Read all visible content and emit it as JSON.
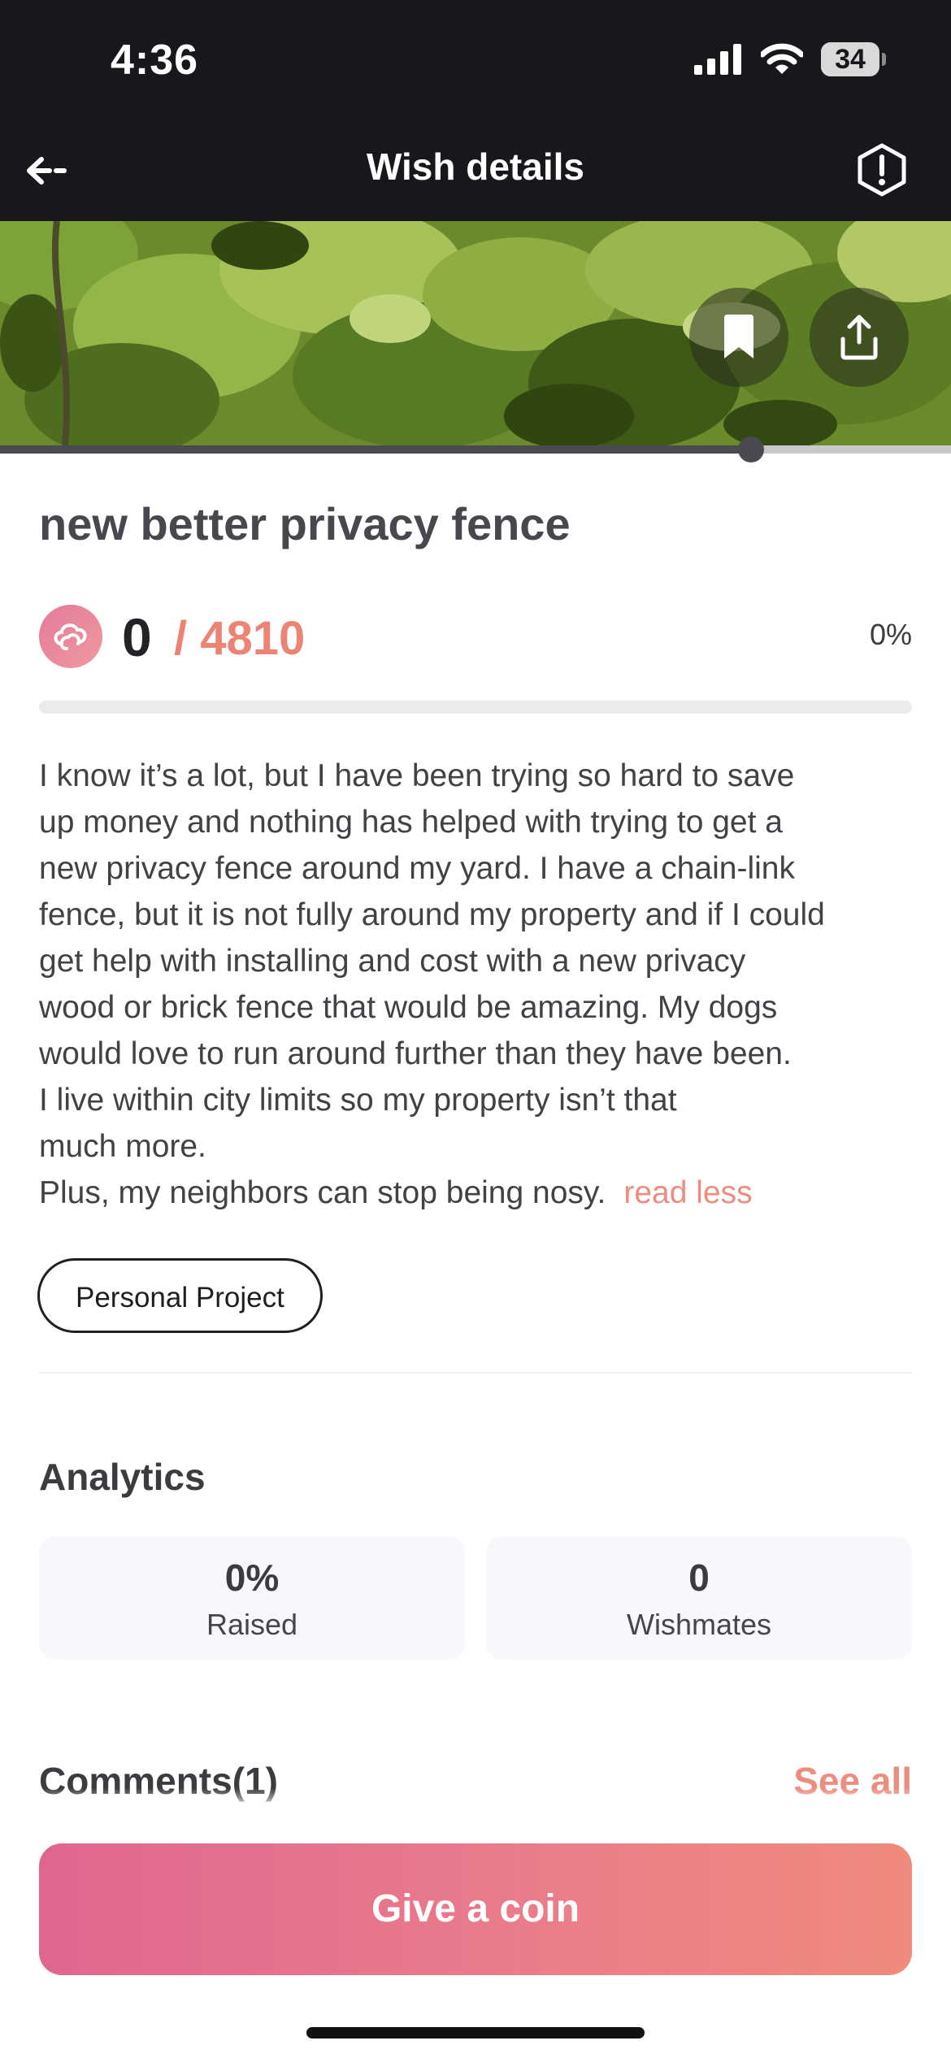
{
  "status_bar": {
    "time": "4:36",
    "battery": "34",
    "battery_level": 0.34,
    "icons": [
      "signal-icon",
      "wifi-icon",
      "battery-icon"
    ]
  },
  "nav": {
    "title": "Wish details",
    "back_icon": "arrow-left-icon",
    "report_icon": "alert-octagon-icon"
  },
  "hero": {
    "actions": [
      "bookmark-icon",
      "share-icon"
    ],
    "media_progress": 0.79
  },
  "wish": {
    "title": "new better privacy fence",
    "raised": "0",
    "goal": "/ 4810",
    "percent": "0%",
    "progress_fraction": 0,
    "description_lines": [
      "I know it’s a lot, but I have been trying so hard to save",
      "up money and nothing has helped with trying to get a",
      "new privacy fence around my yard. I have a chain-link",
      "fence, but it is not fully around my property and if I could",
      "get help with installing and cost with a new privacy",
      "wood or brick fence that would be amazing. My dogs",
      "would love to run around further than they have been.",
      "I live within city limits so my property isn’t that",
      "much more.",
      "Plus, my neighbors can stop being nosy."
    ],
    "read_less": "read less",
    "tag": "Personal Project"
  },
  "analytics": {
    "title": "Analytics",
    "raised_value": "0%",
    "raised_label": "Raised",
    "wishmates_value": "0",
    "wishmates_label": "Wishmates"
  },
  "comments": {
    "title": "Comments(1)",
    "see_all": "See all"
  },
  "cta": {
    "label": "Give a coin"
  },
  "colors": {
    "accent": "#ec8476",
    "cta_start": "#e0668f",
    "cta_end": "#f08a7c",
    "header_bg": "#16181c"
  }
}
